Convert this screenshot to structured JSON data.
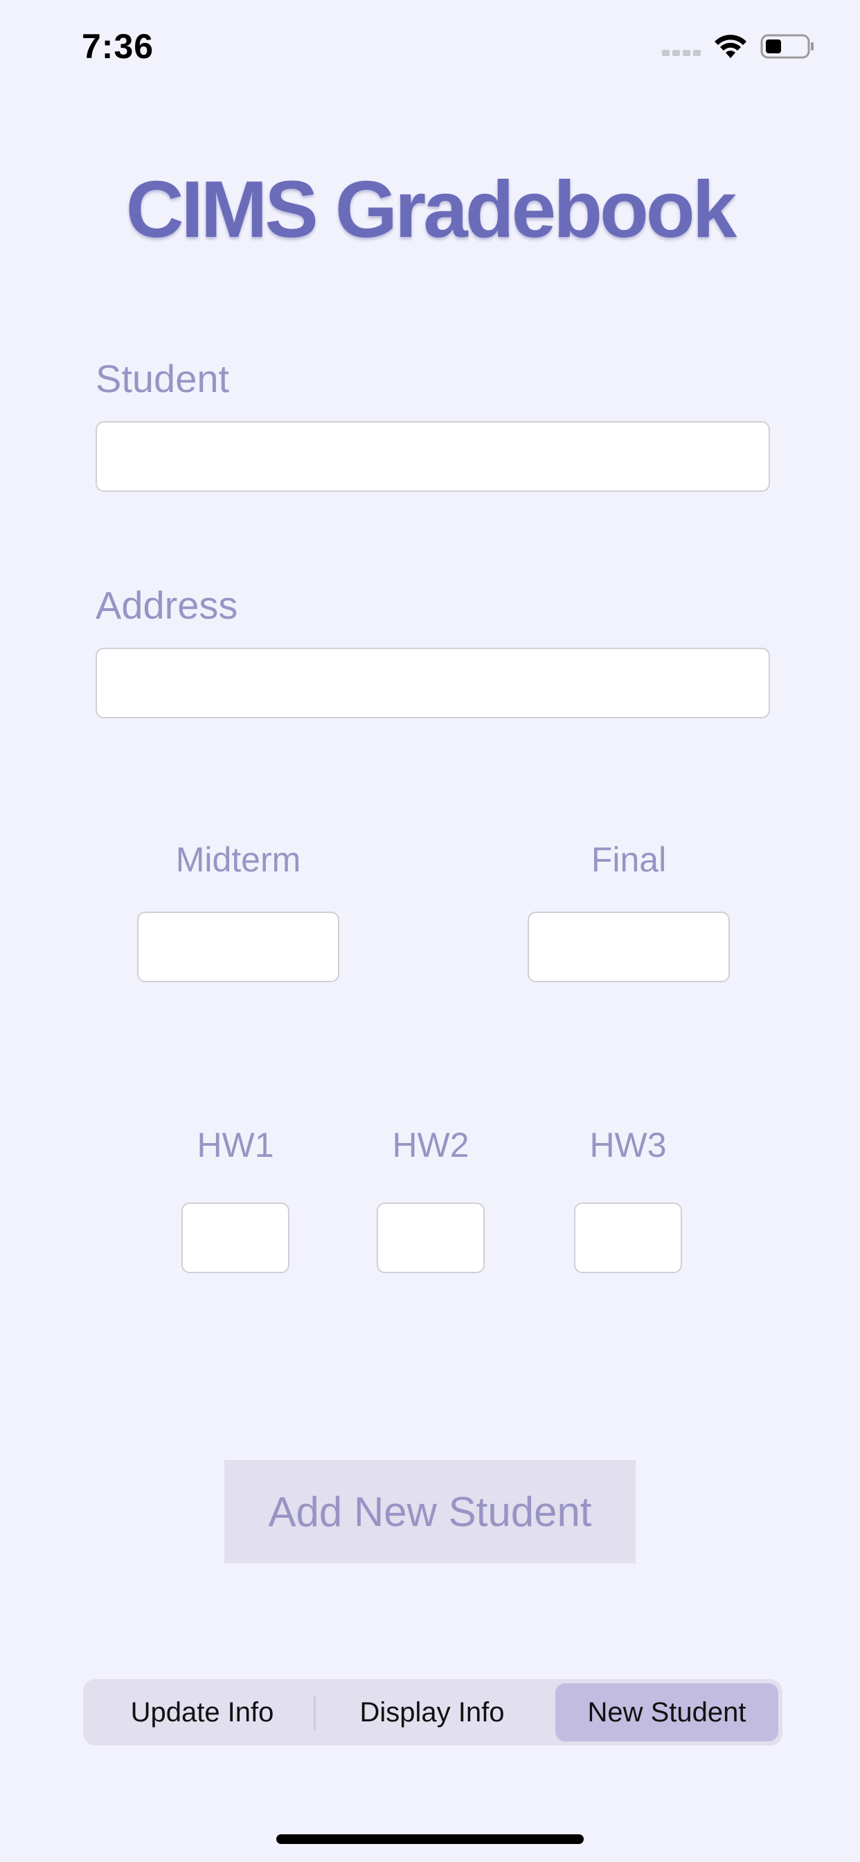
{
  "status_bar": {
    "time": "7:36"
  },
  "app": {
    "title": "CIMS Gradebook"
  },
  "form": {
    "student_label": "Student",
    "student_value": "",
    "address_label": "Address",
    "address_value": "",
    "midterm_label": "Midterm",
    "midterm_value": "",
    "final_label": "Final",
    "final_value": "",
    "hw1_label": "HW1",
    "hw1_value": "",
    "hw2_label": "HW2",
    "hw2_value": "",
    "hw3_label": "HW3",
    "hw3_value": ""
  },
  "actions": {
    "add_label": "Add New Student"
  },
  "tabs": [
    {
      "label": "Update Info",
      "selected": false
    },
    {
      "label": "Display Info",
      "selected": false
    },
    {
      "label": "New Student",
      "selected": true
    }
  ],
  "colors": {
    "background": "#f2f2fc",
    "title": "#6a6cba",
    "label": "#9894c4",
    "button_bg": "#e2dfee",
    "segment_selected": "#c2bde0"
  },
  "icons": [
    "cellular-signal-icon",
    "wifi-icon",
    "battery-icon"
  ]
}
